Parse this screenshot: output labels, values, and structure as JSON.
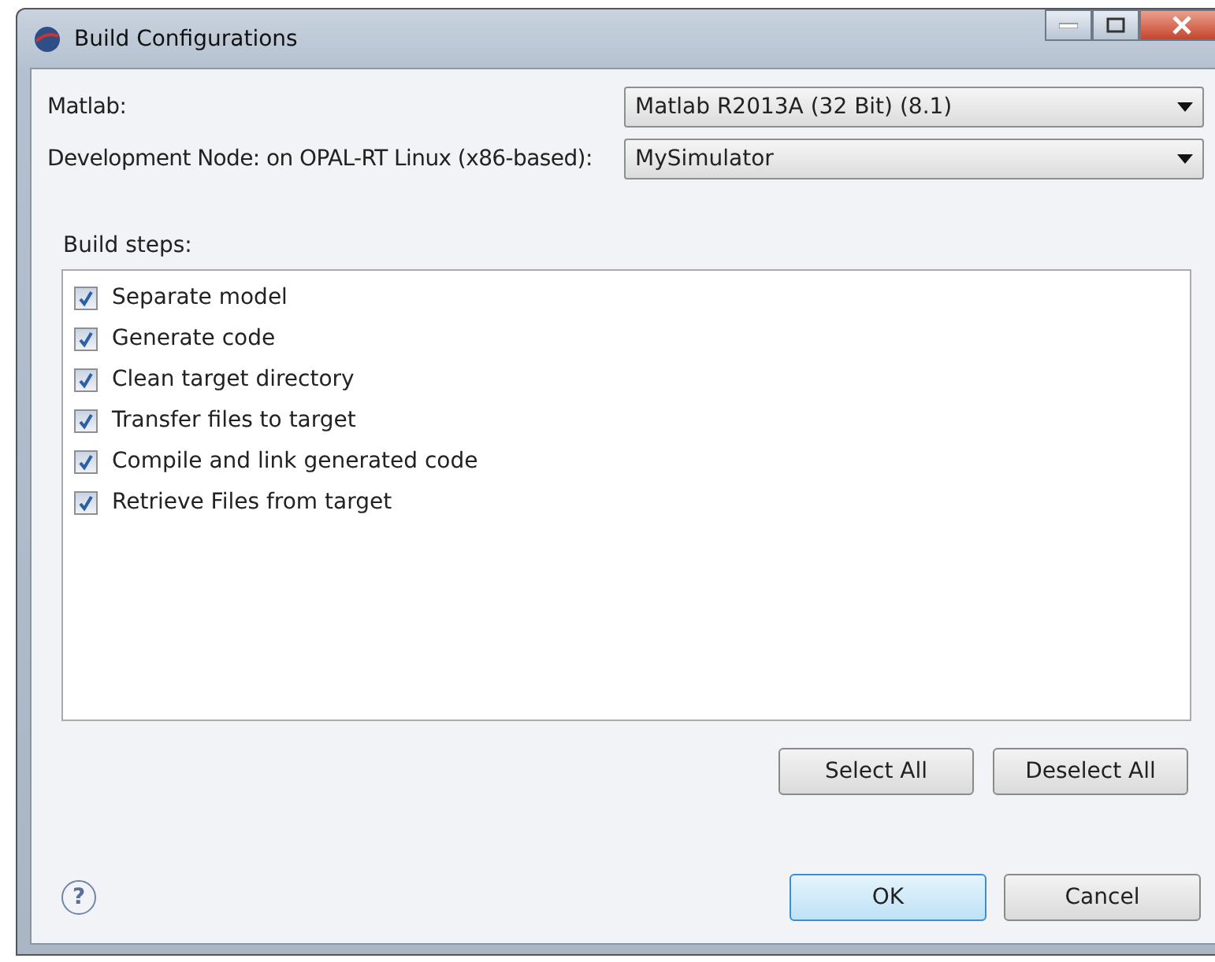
{
  "window": {
    "title": "Build Configurations"
  },
  "fields": [
    {
      "label": "Matlab:",
      "value": "Matlab R2013A (32 Bit) (8.1)"
    },
    {
      "label": "Development Node: on OPAL-RT Linux (x86-based):",
      "value": "MySimulator"
    }
  ],
  "build_steps": {
    "label": "Build steps:",
    "items": [
      {
        "label": "Separate model",
        "checked": true
      },
      {
        "label": "Generate code",
        "checked": true
      },
      {
        "label": "Clean target directory",
        "checked": true
      },
      {
        "label": "Transfer files to target",
        "checked": true
      },
      {
        "label": "Compile and link generated code",
        "checked": true
      },
      {
        "label": "Retrieve Files from target",
        "checked": true
      }
    ],
    "buttons": [
      "Select All",
      "Deselect All"
    ]
  },
  "help": {
    "symbol": "?"
  },
  "dialog_buttons": [
    {
      "label": "OK",
      "default": true
    },
    {
      "label": "Cancel",
      "default": false
    }
  ]
}
